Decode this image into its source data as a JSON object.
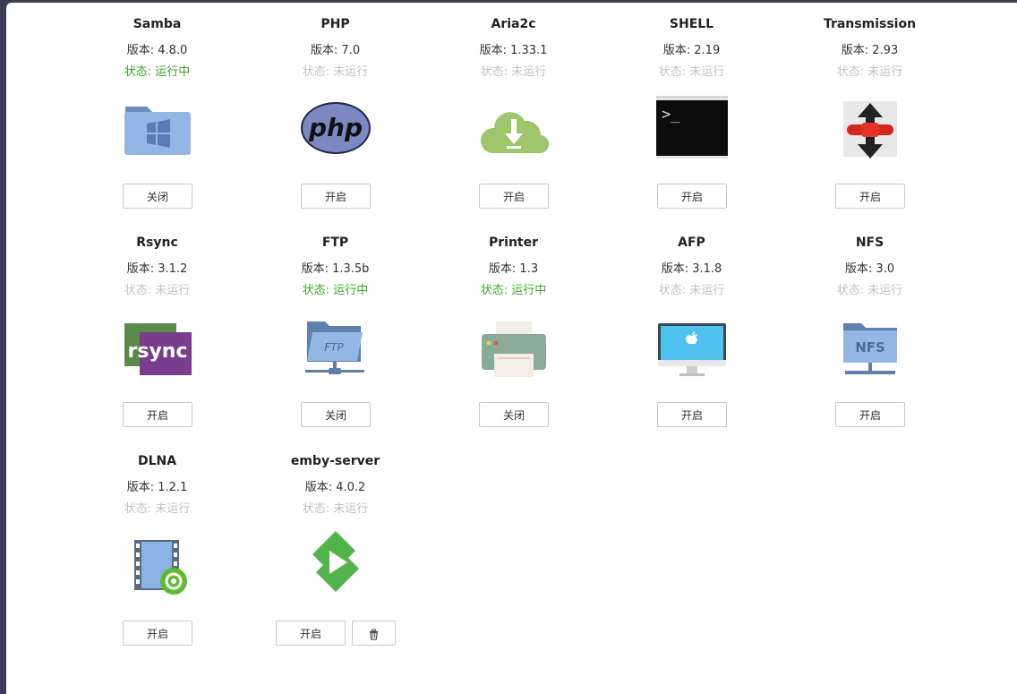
{
  "plugins": [
    {
      "name": "Samba",
      "version": "版本: 4.8.0",
      "status": "状态: 运行中",
      "running": true,
      "action": "关闭",
      "icon": "samba-folder-icon"
    },
    {
      "name": "PHP",
      "version": "版本: 7.0",
      "status": "状态: 未运行",
      "running": false,
      "action": "开启",
      "icon": "php-logo-icon"
    },
    {
      "name": "Aria2c",
      "version": "版本: 1.33.1",
      "status": "状态: 未运行",
      "running": false,
      "action": "开启",
      "icon": "cloud-download-icon"
    },
    {
      "name": "SHELL",
      "version": "版本: 2.19",
      "status": "状态: 未运行",
      "running": false,
      "action": "开启",
      "icon": "terminal-icon"
    },
    {
      "name": "Transmission",
      "version": "版本: 2.93",
      "status": "状态: 未运行",
      "running": false,
      "action": "开启",
      "icon": "transmission-icon"
    },
    {
      "name": "Rsync",
      "version": "版本: 3.1.2",
      "status": "状态: 未运行",
      "running": false,
      "action": "开启",
      "icon": "rsync-icon",
      "icon_text": "rsync"
    },
    {
      "name": "FTP",
      "version": "版本: 1.3.5b",
      "status": "状态: 运行中",
      "running": true,
      "action": "关闭",
      "icon": "ftp-folder-icon",
      "icon_text": "FTP"
    },
    {
      "name": "Printer",
      "version": "版本: 1.3",
      "status": "状态: 运行中",
      "running": true,
      "action": "关闭",
      "icon": "printer-icon"
    },
    {
      "name": "AFP",
      "version": "版本: 3.1.8",
      "status": "状态: 未运行",
      "running": false,
      "action": "开启",
      "icon": "imac-apple-icon"
    },
    {
      "name": "NFS",
      "version": "版本: 3.0",
      "status": "状态: 未运行",
      "running": false,
      "action": "开启",
      "icon": "nfs-folder-icon",
      "icon_text": "NFS"
    },
    {
      "name": "DLNA",
      "version": "版本: 1.2.1",
      "status": "状态: 未运行",
      "running": false,
      "action": "开启",
      "icon": "dlna-film-icon"
    },
    {
      "name": "emby-server",
      "version": "版本: 4.0.2",
      "status": "状态: 未运行",
      "running": false,
      "action": "开启",
      "icon": "emby-play-icon",
      "delete_icon": "trash-icon"
    }
  ],
  "colors": {
    "running": "#3fa528",
    "stopped": "#c2c2c2"
  }
}
